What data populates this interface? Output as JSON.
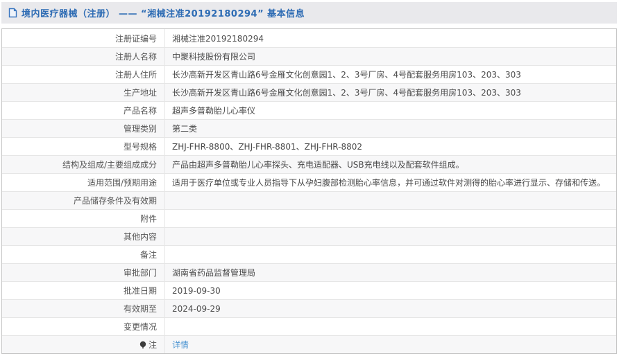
{
  "header": {
    "title": "境内医疗器械（注册） —— “湘械注准20192180294” 基本信息",
    "icon": "document-icon"
  },
  "colors": {
    "header_bg": "#e9e9ec",
    "header_text": "#2e6cb4",
    "table_border": "#c6c6c6",
    "row_alt_bg": "#f7f7f8",
    "link": "#4f96d2"
  },
  "table": {
    "rows": [
      {
        "label": "注册证编号",
        "value": "湘械注准20192180294"
      },
      {
        "label": "注册人名称",
        "value": "中聚科技股份有限公司"
      },
      {
        "label": "注册人住所",
        "value": "长沙高新开发区青山路6号金雁文化创意园1、2、3号厂房、4号配套服务用房103、203、303"
      },
      {
        "label": "生产地址",
        "value": "长沙高新开发区青山路6号金雁文化创意园1、2、3号厂房、4号配套服务用房103、203、303"
      },
      {
        "label": "产品名称",
        "value": "超声多普勒胎儿心率仪"
      },
      {
        "label": "管理类别",
        "value": "第二类"
      },
      {
        "label": "型号规格",
        "value": "ZHJ-FHR-8800、ZHJ-FHR-8801、ZHJ-FHR-8802"
      },
      {
        "label": "结构及组成/主要组成成分",
        "value": "产品由超声多普勒胎儿心率探头、充电适配器、USB充电线以及配套软件组成。"
      },
      {
        "label": "适用范围/预期用途",
        "value": "适用于医疗单位或专业人员指导下从孕妇腹部检测胎心率信息，并可通过软件对测得的胎心率进行显示、存储和传送。"
      },
      {
        "label": "产品储存条件及有效期",
        "value": ""
      },
      {
        "label": "附件",
        "value": ""
      },
      {
        "label": "其他内容",
        "value": ""
      },
      {
        "label": "备注",
        "value": ""
      },
      {
        "label": "审批部门",
        "value": "湖南省药品监督管理局"
      },
      {
        "label": "批准日期",
        "value": "2019-09-30"
      },
      {
        "label": "有效期至",
        "value": "2024-09-29"
      },
      {
        "label": "变更情况",
        "value": ""
      },
      {
        "label": "注",
        "value": "详情",
        "label_icon": "note-balloon-icon",
        "value_is_link": true
      }
    ]
  }
}
